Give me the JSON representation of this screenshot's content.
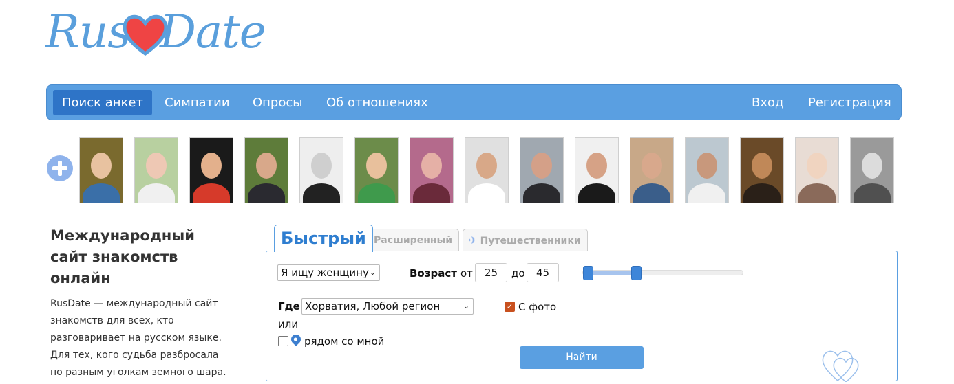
{
  "logo": {
    "part1": "Rus",
    "part2": "Date",
    "heart_color": "#ef4444",
    "text_color": "#5a9fdc"
  },
  "nav": {
    "left": [
      "Поиск анкет",
      "Симпатии",
      "Опросы",
      "Об отношениях"
    ],
    "right": [
      "Вход",
      "Регистрация"
    ],
    "active_index": 0,
    "background": "#5a9fe1"
  },
  "add_photo_icon": "plus-circle-icon",
  "thumbnails": [
    {
      "desc": "woman-golden-wreath",
      "face": "#e8c2a0",
      "bg": "#7a6a2e",
      "body": "#3a6fa8"
    },
    {
      "desc": "woman-light-hair",
      "face": "#eec8b4",
      "bg": "#b8d0a0",
      "body": "#f0f0f0"
    },
    {
      "desc": "man-red-shirt",
      "face": "#e3b08c",
      "bg": "#1a1a1a",
      "body": "#d63a2a"
    },
    {
      "desc": "woman-forest",
      "face": "#d8a88a",
      "bg": "#5e7c3a",
      "body": "#2a2a30"
    },
    {
      "desc": "woman-bw",
      "face": "#cfcfcf",
      "bg": "#eeeeee",
      "body": "#222222"
    },
    {
      "desc": "woman-green-dress",
      "face": "#e8c09c",
      "bg": "#6c8c4a",
      "body": "#3f9a4c"
    },
    {
      "desc": "woman-pink",
      "face": "#e5b0a6",
      "bg": "#b46a8c",
      "body": "#6a2a3a"
    },
    {
      "desc": "man-phone-mirror",
      "face": "#d8a888",
      "bg": "#e0e0e0",
      "body": "#ffffff"
    },
    {
      "desc": "man-office",
      "face": "#d4a088",
      "bg": "#a0a8b0",
      "body": "#2a2a2e"
    },
    {
      "desc": "man-dark-hair",
      "face": "#d6a286",
      "bg": "#f0f0f0",
      "body": "#1a1a1a"
    },
    {
      "desc": "man-sitting",
      "face": "#d8a88c",
      "bg": "#c8a888",
      "body": "#3a5e8a"
    },
    {
      "desc": "man-glasses",
      "face": "#c8987c",
      "bg": "#bcc8d0",
      "body": "#f0f0f0"
    },
    {
      "desc": "man-sepia",
      "face": "#c08858",
      "bg": "#6a4a28",
      "body": "#2a2018"
    },
    {
      "desc": "woman-blonde",
      "face": "#f0d4c0",
      "bg": "#e8dcd4",
      "body": "#8a6a5a"
    },
    {
      "desc": "woman-grey",
      "face": "#dcdcdc",
      "bg": "#9a9a9a",
      "body": "#505050"
    }
  ],
  "intro": {
    "title": "Международный сайт знакомств онлайн",
    "text": "RusDate — международный сайт знакомств для всех, кто разговаривает на русском языке. Для тех, кого судьба разбросала по разным уголкам земного шара. Г"
  },
  "tabs": [
    {
      "label": "Быстрый",
      "active": true
    },
    {
      "label": "Расширенный",
      "active": false
    },
    {
      "label": "Путешественники",
      "active": false,
      "icon": "airplane-icon"
    }
  ],
  "search": {
    "looking_for": "Я ищу женщину",
    "age_label": "Возраст",
    "from_label": "от",
    "age_from": "25",
    "to_label": "до",
    "age_to": "45",
    "age_slider": {
      "min": 18,
      "max": 99,
      "from": 25,
      "to": 45
    },
    "where_label": "Где",
    "where_value": "Хорватия, Любой регион",
    "or_label": "или",
    "near_me_label": "рядом со мной",
    "near_me_checked": false,
    "with_photo_label": "С фото",
    "with_photo_checked": true,
    "find_button": "Найти"
  }
}
